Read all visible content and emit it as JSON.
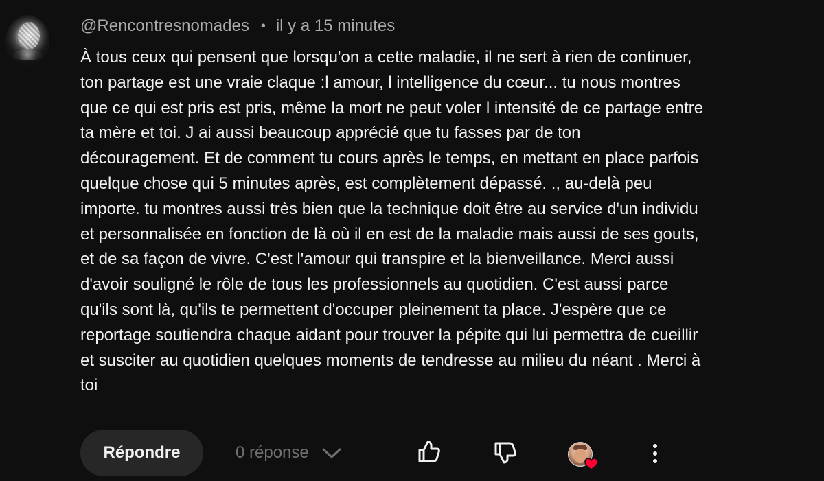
{
  "comment": {
    "author": "@Rencontresnomades",
    "separator": "•",
    "timestamp": "il y a 15 minutes",
    "text": "À tous ceux qui pensent que lorsqu'on a cette maladie, il ne sert à rien de continuer,\nton partage est une vraie claque :l amour,  l intelligence du cœur... tu nous montres\nque ce qui est pris est pris, même la mort ne peut voler l intensité de ce partage entre\nta mère et toi.  J ai aussi beaucoup apprécié que tu fasses par de ton\ndécouragement. Et de comment tu cours après le temps,  en mettant en place parfois\nquelque chose qui 5 minutes après, est complètement dépassé. ., au-delà peu\nimporte. tu montres aussi très bien que la technique doit être au service d'un individu\net personnalisée en fonction de là où il en est de la maladie mais aussi de ses gouts,\net de sa façon de vivre. C'est l'amour qui transpire et la bienveillance. Merci aussi\nd'avoir souligné le rôle de tous les professionnels au quotidien. C'est aussi parce\nqu'ils sont là, qu'ils te permettent d'occuper pleinement ta place. J'espère que ce\nreportage soutiendra chaque aidant pour trouver la pépite qui lui permettra de cueillir\net susciter au quotidien quelques moments de tendresse au milieu du néant . Merci à\ntoi"
  },
  "actions": {
    "reply_label": "Répondre",
    "reply_count_label": "0 réponse"
  },
  "icons": {
    "avatar": "globe-avatar",
    "reply_dropdown": "chevron-down-icon",
    "like": "thumbs-up-icon",
    "dislike": "thumbs-down-icon",
    "creator_heart": "heart-icon",
    "more": "more-vertical-icon"
  },
  "colors": {
    "background": "#0f0f0f",
    "text_primary": "#f1f1f1",
    "text_secondary": "#aaaaaa",
    "text_muted": "#717171",
    "button_bg": "#272727",
    "heart": "#ff0033"
  }
}
